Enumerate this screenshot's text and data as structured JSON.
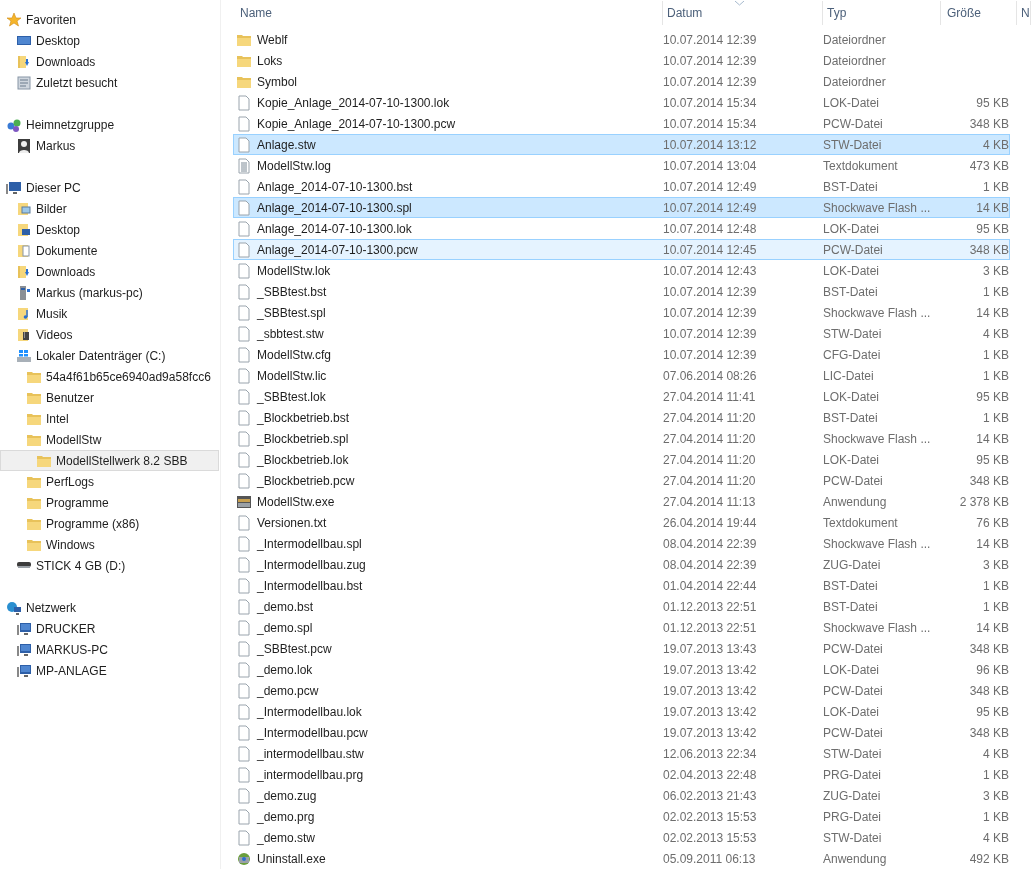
{
  "sidebar": {
    "sections": [
      {
        "label": "Favoriten",
        "kind": "star",
        "selected": false,
        "children": [
          {
            "label": "Desktop",
            "kind": "desktop",
            "selected": false
          },
          {
            "label": "Downloads",
            "kind": "downloads",
            "selected": false
          },
          {
            "label": "Zuletzt besucht",
            "kind": "recent",
            "selected": false
          }
        ]
      },
      {
        "label": "Heimnetzgruppe",
        "kind": "homegroup",
        "selected": false,
        "children": [
          {
            "label": "Markus",
            "kind": "user",
            "selected": false
          }
        ]
      },
      {
        "label": "Dieser PC",
        "kind": "pc",
        "selected": false,
        "children": [
          {
            "label": "Bilder",
            "kind": "pictures",
            "selected": false
          },
          {
            "label": "Desktop",
            "kind": "desktopfolder",
            "selected": false
          },
          {
            "label": "Dokumente",
            "kind": "documents",
            "selected": false
          },
          {
            "label": "Downloads",
            "kind": "downloads",
            "selected": false
          },
          {
            "label": "Markus (markus-pc)",
            "kind": "netdrive",
            "selected": false
          },
          {
            "label": "Musik",
            "kind": "music",
            "selected": false
          },
          {
            "label": "Videos",
            "kind": "videos",
            "selected": false
          },
          {
            "label": "Lokaler Datenträger (C:)",
            "kind": "drive",
            "selected": false,
            "children": [
              {
                "label": "54a4f61b65ce6940ad9a58fcc6",
                "kind": "folder",
                "selected": false
              },
              {
                "label": "Benutzer",
                "kind": "folder",
                "selected": false
              },
              {
                "label": "Intel",
                "kind": "folder",
                "selected": false
              },
              {
                "label": "ModellStw",
                "kind": "folder",
                "selected": false,
                "children": [
                  {
                    "label": "ModellStellwerk 8.2 SBB",
                    "kind": "folder",
                    "selected": true
                  }
                ]
              },
              {
                "label": "PerfLogs",
                "kind": "folder",
                "selected": false
              },
              {
                "label": "Programme",
                "kind": "folder",
                "selected": false
              },
              {
                "label": "Programme (x86)",
                "kind": "folder",
                "selected": false
              },
              {
                "label": "Windows",
                "kind": "folder",
                "selected": false
              }
            ]
          },
          {
            "label": "STICK 4 GB (D:)",
            "kind": "usb",
            "selected": false
          }
        ]
      },
      {
        "label": "Netzwerk",
        "kind": "network",
        "selected": false,
        "children": [
          {
            "label": "DRUCKER",
            "kind": "computer",
            "selected": false
          },
          {
            "label": "MARKUS-PC",
            "kind": "computer",
            "selected": false
          },
          {
            "label": "MP-ANLAGE",
            "kind": "computer",
            "selected": false
          }
        ]
      }
    ]
  },
  "file_list": {
    "columns": [
      {
        "label": "Name",
        "sorted": false
      },
      {
        "label": "Datum",
        "sorted": true
      },
      {
        "label": "Typ",
        "sorted": false
      },
      {
        "label": "Größe",
        "sorted": false
      },
      {
        "label": "N"
      }
    ],
    "rows": [
      {
        "name": "Weblf",
        "date": "10.07.2014 12:39",
        "type": "Dateiordner",
        "size": "",
        "kind": "folder",
        "selected": false,
        "hovered": false
      },
      {
        "name": "Loks",
        "date": "10.07.2014 12:39",
        "type": "Dateiordner",
        "size": "",
        "kind": "folder",
        "selected": false,
        "hovered": false
      },
      {
        "name": "Symbol",
        "date": "10.07.2014 12:39",
        "type": "Dateiordner",
        "size": "",
        "kind": "folder",
        "selected": false,
        "hovered": false
      },
      {
        "name": "Kopie_Anlage_2014-07-10-1300.lok",
        "date": "10.07.2014 15:34",
        "type": "LOK-Datei",
        "size": "95 KB",
        "kind": "file",
        "selected": false,
        "hovered": false
      },
      {
        "name": "Kopie_Anlage_2014-07-10-1300.pcw",
        "date": "10.07.2014 15:34",
        "type": "PCW-Datei",
        "size": "348 KB",
        "kind": "file",
        "selected": false,
        "hovered": false
      },
      {
        "name": "Anlage.stw",
        "date": "10.07.2014 13:12",
        "type": "STW-Datei",
        "size": "4 KB",
        "kind": "file",
        "selected": true,
        "hovered": false
      },
      {
        "name": "ModellStw.log",
        "date": "10.07.2014 13:04",
        "type": "Textdokument",
        "size": "473 KB",
        "kind": "text",
        "selected": false,
        "hovered": false
      },
      {
        "name": "Anlage_2014-07-10-1300.bst",
        "date": "10.07.2014 12:49",
        "type": "BST-Datei",
        "size": "1 KB",
        "kind": "file",
        "selected": false,
        "hovered": false
      },
      {
        "name": "Anlage_2014-07-10-1300.spl",
        "date": "10.07.2014 12:49",
        "type": "Shockwave Flash ...",
        "size": "14 KB",
        "kind": "file",
        "selected": true,
        "hovered": false
      },
      {
        "name": "Anlage_2014-07-10-1300.lok",
        "date": "10.07.2014 12:48",
        "type": "LOK-Datei",
        "size": "95 KB",
        "kind": "file",
        "selected": false,
        "hovered": false
      },
      {
        "name": "Anlage_2014-07-10-1300.pcw",
        "date": "10.07.2014 12:45",
        "type": "PCW-Datei",
        "size": "348 KB",
        "kind": "file",
        "selected": false,
        "hovered": true
      },
      {
        "name": "ModellStw.lok",
        "date": "10.07.2014 12:43",
        "type": "LOK-Datei",
        "size": "3 KB",
        "kind": "file",
        "selected": false,
        "hovered": false
      },
      {
        "name": "_SBBtest.bst",
        "date": "10.07.2014 12:39",
        "type": "BST-Datei",
        "size": "1 KB",
        "kind": "file",
        "selected": false,
        "hovered": false
      },
      {
        "name": "_SBBtest.spl",
        "date": "10.07.2014 12:39",
        "type": "Shockwave Flash ...",
        "size": "14 KB",
        "kind": "file",
        "selected": false,
        "hovered": false
      },
      {
        "name": "_sbbtest.stw",
        "date": "10.07.2014 12:39",
        "type": "STW-Datei",
        "size": "4 KB",
        "kind": "file",
        "selected": false,
        "hovered": false
      },
      {
        "name": "ModellStw.cfg",
        "date": "10.07.2014 12:39",
        "type": "CFG-Datei",
        "size": "1 KB",
        "kind": "file",
        "selected": false,
        "hovered": false
      },
      {
        "name": "ModellStw.lic",
        "date": "07.06.2014 08:26",
        "type": "LIC-Datei",
        "size": "1 KB",
        "kind": "file",
        "selected": false,
        "hovered": false
      },
      {
        "name": "_SBBtest.lok",
        "date": "27.04.2014 11:41",
        "type": "LOK-Datei",
        "size": "95 KB",
        "kind": "file",
        "selected": false,
        "hovered": false
      },
      {
        "name": "_Blockbetrieb.bst",
        "date": "27.04.2014 11:20",
        "type": "BST-Datei",
        "size": "1 KB",
        "kind": "file",
        "selected": false,
        "hovered": false
      },
      {
        "name": "_Blockbetrieb.spl",
        "date": "27.04.2014 11:20",
        "type": "Shockwave Flash ...",
        "size": "14 KB",
        "kind": "file",
        "selected": false,
        "hovered": false
      },
      {
        "name": "_Blockbetrieb.lok",
        "date": "27.04.2014 11:20",
        "type": "LOK-Datei",
        "size": "95 KB",
        "kind": "file",
        "selected": false,
        "hovered": false
      },
      {
        "name": "_Blockbetrieb.pcw",
        "date": "27.04.2014 11:20",
        "type": "PCW-Datei",
        "size": "348 KB",
        "kind": "file",
        "selected": false,
        "hovered": false
      },
      {
        "name": "ModellStw.exe",
        "date": "27.04.2014 11:13",
        "type": "Anwendung",
        "size": "2 378 KB",
        "kind": "app",
        "selected": false,
        "hovered": false
      },
      {
        "name": "Versionen.txt",
        "date": "26.04.2014 19:44",
        "type": "Textdokument",
        "size": "76 KB",
        "kind": "file",
        "selected": false,
        "hovered": false
      },
      {
        "name": "_Intermodellbau.spl",
        "date": "08.04.2014 22:39",
        "type": "Shockwave Flash ...",
        "size": "14 KB",
        "kind": "file",
        "selected": false,
        "hovered": false
      },
      {
        "name": "_Intermodellbau.zug",
        "date": "08.04.2014 22:39",
        "type": "ZUG-Datei",
        "size": "3 KB",
        "kind": "file",
        "selected": false,
        "hovered": false
      },
      {
        "name": "_Intermodellbau.bst",
        "date": "01.04.2014 22:44",
        "type": "BST-Datei",
        "size": "1 KB",
        "kind": "file",
        "selected": false,
        "hovered": false
      },
      {
        "name": "_demo.bst",
        "date": "01.12.2013 22:51",
        "type": "BST-Datei",
        "size": "1 KB",
        "kind": "file",
        "selected": false,
        "hovered": false
      },
      {
        "name": "_demo.spl",
        "date": "01.12.2013 22:51",
        "type": "Shockwave Flash ...",
        "size": "14 KB",
        "kind": "file",
        "selected": false,
        "hovered": false
      },
      {
        "name": "_SBBtest.pcw",
        "date": "19.07.2013 13:43",
        "type": "PCW-Datei",
        "size": "348 KB",
        "kind": "file",
        "selected": false,
        "hovered": false
      },
      {
        "name": "_demo.lok",
        "date": "19.07.2013 13:42",
        "type": "LOK-Datei",
        "size": "96 KB",
        "kind": "file",
        "selected": false,
        "hovered": false
      },
      {
        "name": "_demo.pcw",
        "date": "19.07.2013 13:42",
        "type": "PCW-Datei",
        "size": "348 KB",
        "kind": "file",
        "selected": false,
        "hovered": false
      },
      {
        "name": "_Intermodellbau.lok",
        "date": "19.07.2013 13:42",
        "type": "LOK-Datei",
        "size": "95 KB",
        "kind": "file",
        "selected": false,
        "hovered": false
      },
      {
        "name": "_Intermodellbau.pcw",
        "date": "19.07.2013 13:42",
        "type": "PCW-Datei",
        "size": "348 KB",
        "kind": "file",
        "selected": false,
        "hovered": false
      },
      {
        "name": "_intermodellbau.stw",
        "date": "12.06.2013 22:34",
        "type": "STW-Datei",
        "size": "4 KB",
        "kind": "file",
        "selected": false,
        "hovered": false
      },
      {
        "name": "_intermodellbau.prg",
        "date": "02.04.2013 22:48",
        "type": "PRG-Datei",
        "size": "1 KB",
        "kind": "file",
        "selected": false,
        "hovered": false
      },
      {
        "name": "_demo.zug",
        "date": "06.02.2013 21:43",
        "type": "ZUG-Datei",
        "size": "3 KB",
        "kind": "file",
        "selected": false,
        "hovered": false
      },
      {
        "name": "_demo.prg",
        "date": "02.02.2013 15:53",
        "type": "PRG-Datei",
        "size": "1 KB",
        "kind": "file",
        "selected": false,
        "hovered": false
      },
      {
        "name": "_demo.stw",
        "date": "02.02.2013 15:53",
        "type": "STW-Datei",
        "size": "4 KB",
        "kind": "file",
        "selected": false,
        "hovered": false
      },
      {
        "name": "Uninstall.exe",
        "date": "05.09.2011 06:13",
        "type": "Anwendung",
        "size": "492 KB",
        "kind": "installer",
        "selected": false,
        "hovered": false
      }
    ]
  }
}
